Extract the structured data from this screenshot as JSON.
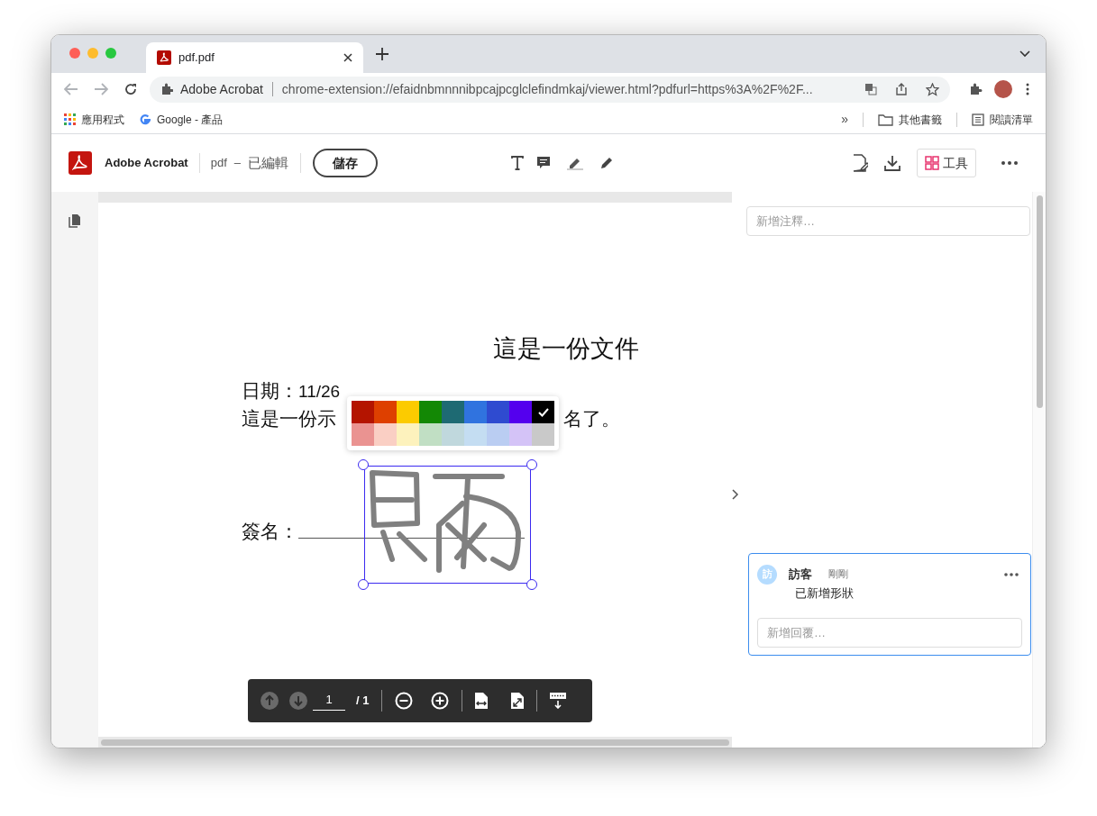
{
  "browser": {
    "tab_title": "pdf.pdf",
    "site_chip": "Adobe Acrobat",
    "url": "chrome-extension://efaidnbmnnnibpcajpcglclefindmkaj/viewer.html?pdfurl=https%3A%2F%2F...",
    "bookmarks": [
      {
        "kind": "apps",
        "label": "應用程式"
      },
      {
        "kind": "google",
        "label": "Google - 產品"
      }
    ],
    "overflow": "»",
    "right_bookmarks": [
      {
        "kind": "folder",
        "label": "其他書籤"
      },
      {
        "kind": "list",
        "label": "閱讀清單"
      }
    ]
  },
  "app_bar": {
    "app_name": "Adobe Acrobat",
    "doc_name": "pdf",
    "dash": "–",
    "status": "已編輯",
    "save": "儲存",
    "tools": "工具"
  },
  "document": {
    "title": "這是一份文件",
    "date_label": "日期：",
    "date_value": "11/26",
    "line_left": "這是一份示",
    "line_right": "名了。",
    "signature_label": "簽名："
  },
  "palette": {
    "swatches": [
      {
        "color": "#b41400",
        "selected": false
      },
      {
        "color": "#de4000",
        "selected": false
      },
      {
        "color": "#fccb00",
        "selected": false
      },
      {
        "color": "#138805",
        "selected": false
      },
      {
        "color": "#1e6a73",
        "selected": false
      },
      {
        "color": "#3073df",
        "selected": false
      },
      {
        "color": "#2f4bd0",
        "selected": false
      },
      {
        "color": "#5400ee",
        "selected": false
      },
      {
        "color": "#000000",
        "selected": true
      },
      {
        "color": "#ea9391",
        "selected": false
      },
      {
        "color": "#facfc4",
        "selected": false
      },
      {
        "color": "#fdf2bd",
        "selected": false
      },
      {
        "color": "#c1dfc4",
        "selected": false
      },
      {
        "color": "#c0d8dd",
        "selected": false
      },
      {
        "color": "#c4ddf2",
        "selected": false
      },
      {
        "color": "#bacdf2",
        "selected": false
      },
      {
        "color": "#d4c3f7",
        "selected": false
      },
      {
        "color": "#c9c9c9",
        "selected": false
      }
    ]
  },
  "comments": {
    "placeholder": "新增注釋…",
    "card": {
      "avatar": "訪",
      "author": "訪客",
      "time": "剛剛",
      "text": "已新增形狀",
      "reply_placeholder": "新增回覆…"
    }
  },
  "page_nav": {
    "page": "1",
    "total": "/ 1"
  }
}
